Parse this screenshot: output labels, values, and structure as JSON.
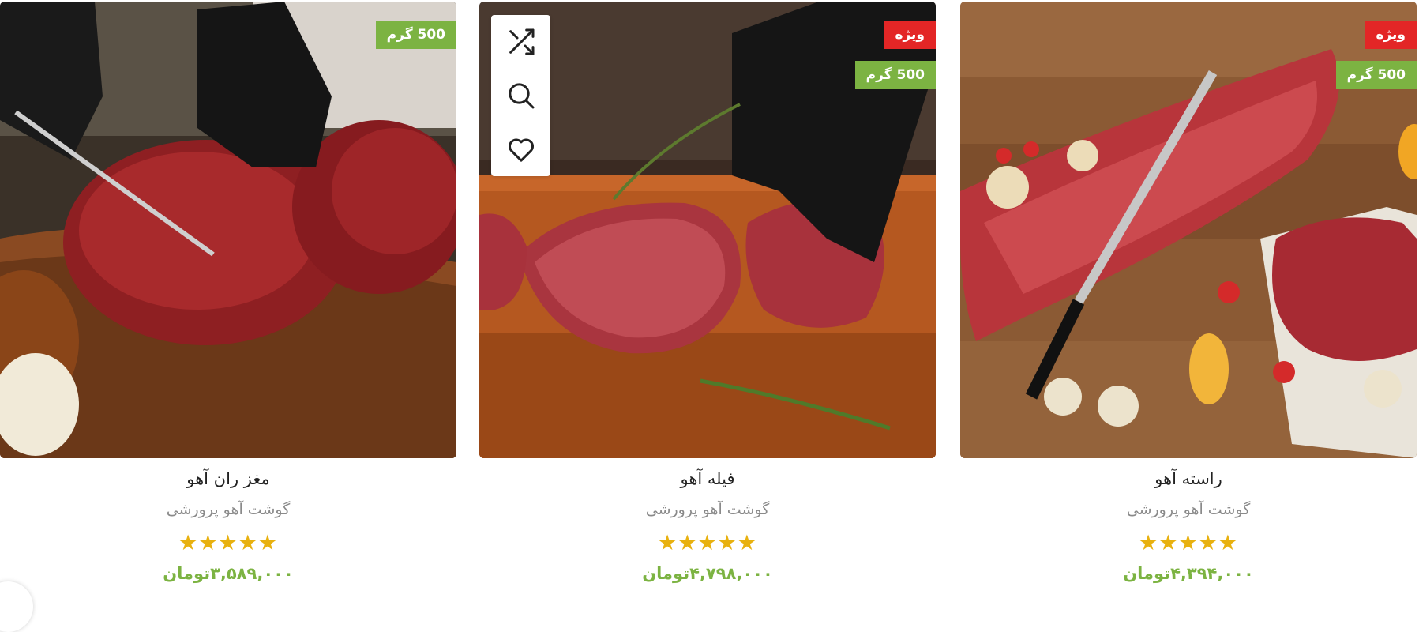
{
  "products": [
    {
      "title": "مغز ران آهو",
      "category": "گوشت آهو پرورشی",
      "price": "۳,۵۸۹,۰۰۰تومان",
      "rating": 5,
      "stars": "★★★★★",
      "badges": [
        "500 گرم"
      ]
    },
    {
      "title": "فیله آهو",
      "category": "گوشت آهو پرورشی",
      "price": "۴,۷۹۸,۰۰۰تومان",
      "rating": 5,
      "stars": "★★★★★",
      "badges": [
        "ویژه",
        "500 گرم"
      ],
      "actions": [
        "shuffle-icon",
        "search-icon",
        "heart-icon"
      ]
    },
    {
      "title": "راسته آهو",
      "category": "گوشت آهو پرورشی",
      "price": "۴,۳۹۴,۰۰۰تومان",
      "rating": 5,
      "stars": "★★★★★",
      "badges": [
        "ویژه",
        "500 گرم"
      ]
    }
  ],
  "colors": {
    "accent_green": "#7cb342",
    "special_red": "#e32626",
    "star_yellow": "#e8b10f"
  }
}
